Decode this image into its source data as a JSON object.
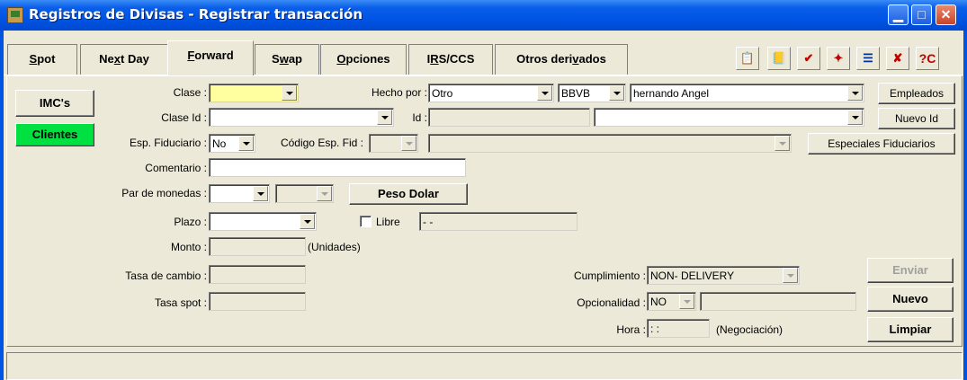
{
  "window": {
    "title": "Registros de Divisas - Registrar transacción"
  },
  "tabs": [
    {
      "label": "Spot",
      "key": "S"
    },
    {
      "label": "Next Day",
      "key": "x"
    },
    {
      "label": "Forward",
      "key": "F"
    },
    {
      "label": "Swap",
      "key": "w"
    },
    {
      "label": "Opciones",
      "key": "O"
    },
    {
      "label": "IRS/CCS",
      "key": "R"
    },
    {
      "label": "Otros derivados",
      "key": "v"
    }
  ],
  "active_tab": "Forward",
  "side_buttons": {
    "imcs": "IMC's",
    "clientes": "Clientes"
  },
  "form": {
    "clase_label": "Clase :",
    "clase_value": "",
    "hecho_por_label": "Hecho por :",
    "hecho_por_value": "Otro",
    "banco_value": "BBVB",
    "usuario_value": "hernando Angel",
    "empleados_button": "Empleados",
    "clase_id_label": "Clase Id :",
    "clase_id_value": "",
    "id_label": "Id :",
    "id_value": "",
    "id_combo_value": "",
    "nuevo_id_button": "Nuevo Id",
    "esp_fiduciario_label": "Esp. Fiduciario :",
    "esp_fiduciario_value": "No",
    "codigo_esp_fid_label": "Código Esp. Fid :",
    "codigo_esp_fid_value": "",
    "especiales_button": "Especiales Fiduciarios",
    "comentario_label": "Comentario :",
    "comentario_value": "",
    "par_monedas_label": "Par de monedas :",
    "par_monedas_1": "",
    "par_monedas_2": "",
    "peso_dolar_button": "Peso Dolar",
    "plazo_label": "Plazo :",
    "plazo_value": "",
    "libre_label": "Libre",
    "libre_checked": false,
    "libre_date": " -  - ",
    "monto_label": "Monto :",
    "monto_value": "",
    "unidades_text": "(Unidades)",
    "tasa_cambio_label": "Tasa de cambio :",
    "tasa_cambio_value": "",
    "tasa_spot_label": "Tasa spot :",
    "tasa_spot_value": "",
    "cumplimiento_label": "Cumplimiento :",
    "cumplimiento_value": "NON- DELIVERY",
    "opcionalidad_label": "Opcionalidad :",
    "opcionalidad_value": "NO",
    "opcionalidad_text": "",
    "hora_label": "Hora :",
    "hora_value": " :  : ",
    "negociacion_text": "(Negociación)"
  },
  "action_buttons": {
    "enviar": "Enviar",
    "nuevo": "Nuevo",
    "limpiar": "Limpiar"
  },
  "colors": {
    "title_bar": "#0054e3",
    "face": "#ece9d8",
    "clientes_bg": "#00e040",
    "clase_bg": "#ffffa0"
  }
}
